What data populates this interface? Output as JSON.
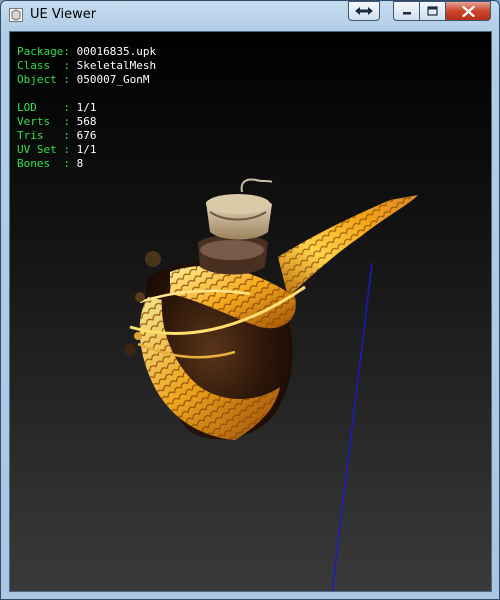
{
  "window": {
    "title": "UE Viewer",
    "icons": {
      "app": "ue-viewer-app-icon",
      "extra": "double-arrow-icon",
      "minimize": "minimize-icon",
      "maximize": "maximize-icon",
      "close": "close-icon"
    }
  },
  "info": {
    "package_label": "Package: ",
    "package_value": "00016835.upk",
    "class_label": "Class  : ",
    "class_value": "SkeletalMesh",
    "object_label": "Object : ",
    "object_value": "050007_GonM",
    "lod_label": "LOD    : ",
    "lod_value": "1/1",
    "verts_label": "Verts  : ",
    "verts_value": "568",
    "tris_label": "Tris   : ",
    "tris_value": "676",
    "uvset_label": "UV Set : ",
    "uvset_value": "1/1",
    "bones_label": "Bones  : ",
    "bones_value": "8"
  },
  "colors": {
    "label_green": "#33e04a",
    "value_white": "#ffffff",
    "viewport_top": "#000000",
    "viewport_bottom": "#3a3a3a",
    "axis_blue": "#1a1ad0",
    "mesh_gold": "#e8a21c"
  }
}
